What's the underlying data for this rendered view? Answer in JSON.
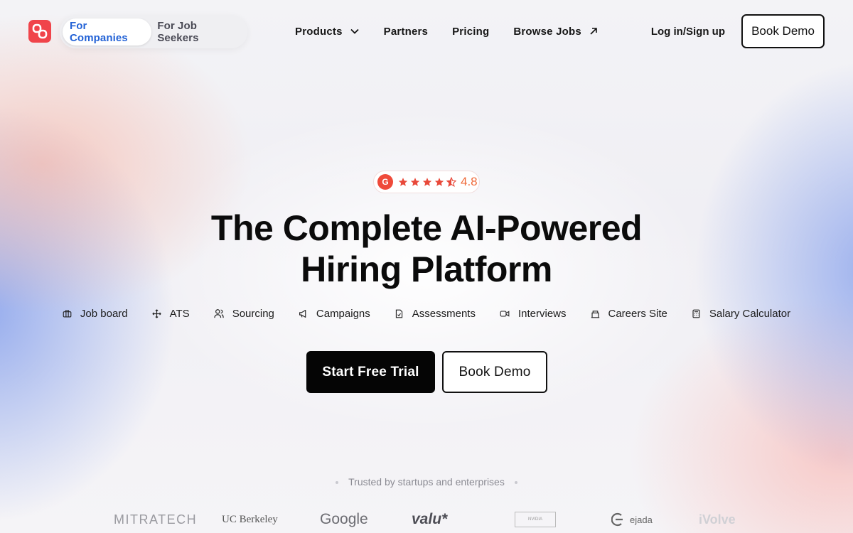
{
  "nav": {
    "audience_tabs": [
      {
        "label": "For Companies",
        "active": true
      },
      {
        "label": "For Job Seekers",
        "active": false
      }
    ],
    "menu": [
      {
        "label": "Products",
        "icon": "chevron-down-icon"
      },
      {
        "label": "Partners"
      },
      {
        "label": "Pricing"
      },
      {
        "label": "Browse Jobs",
        "icon": "arrow-up-right-icon"
      }
    ],
    "login_label": "Log in/Sign up",
    "demo_label": "Book Demo"
  },
  "hero": {
    "rating": {
      "badge": "G",
      "stars": 4.5,
      "score": "4.8"
    },
    "headline_line1": "The Complete AI-Powered",
    "headline_line2": "Hiring Platform",
    "features": [
      {
        "label": "Job board",
        "icon": "briefcase-icon"
      },
      {
        "label": "ATS",
        "icon": "move-icon"
      },
      {
        "label": "Sourcing",
        "icon": "users-icon"
      },
      {
        "label": "Campaigns",
        "icon": "megaphone-icon"
      },
      {
        "label": "Assessments",
        "icon": "file-check-icon"
      },
      {
        "label": "Interviews",
        "icon": "video-icon"
      },
      {
        "label": "Careers Site",
        "icon": "building-icon"
      },
      {
        "label": "Salary Calculator",
        "icon": "calculator-icon"
      }
    ],
    "primary_cta": "Start Free Trial",
    "secondary_cta": "Book Demo"
  },
  "trusted": {
    "label": "Trusted by startups and enterprises",
    "logos": [
      "MITRATECH",
      "UC Berkeley",
      "Google",
      "valu*",
      "NVIDIA",
      "ejada",
      "iVolve"
    ]
  },
  "colors": {
    "brand": "#f0444a",
    "accent_blue": "#2463d6",
    "rating": "#ef6a3a",
    "star": "#e8493a"
  }
}
